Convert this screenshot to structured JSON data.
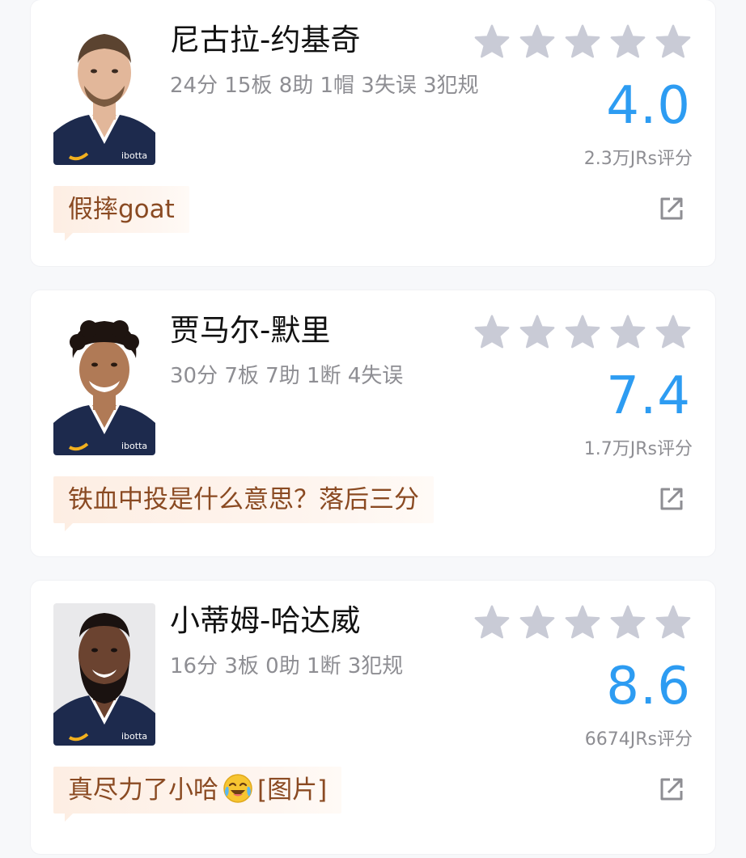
{
  "players": [
    {
      "name": "尼古拉-约基奇",
      "stats": "24分 15板 8助 1帽 3失误 3犯规",
      "score": "4.0",
      "rating_count": "2.3万JRs评分",
      "comment": "假摔goat",
      "stars_filled": 0,
      "skin": "#e2b79a",
      "hair": "#5b4330",
      "avatar_bg": "#ffffff"
    },
    {
      "name": "贾马尔-默里",
      "stats": "30分 7板 7助 1断 4失误",
      "score": "7.4",
      "rating_count": "1.7万JRs评分",
      "comment": "铁血中投是什么意思？落后三分",
      "stars_filled": 0,
      "skin": "#b07a56",
      "hair": "#1e1410",
      "avatar_bg": "#ffffff"
    },
    {
      "name": "小蒂姆-哈达威",
      "stats": "16分 3板 0助 1断 3犯规",
      "score": "8.6",
      "rating_count": "6674JRs评分",
      "comment": "真尽力了小哈",
      "comment_suffix": "[图片]",
      "stars_filled": 0,
      "skin": "#6b4330",
      "hair": "#1a1210",
      "avatar_bg": "#e9e9eb"
    }
  ],
  "colors": {
    "score": "#2d9cf2",
    "star_empty": "#c9cbd6",
    "comment_text": "#8a4a22",
    "stat_text": "#8e8e93"
  },
  "jersey": {
    "text": "ibotta",
    "color": "#1d2a4d"
  },
  "icons": {
    "star": "star-icon",
    "share": "share-icon",
    "emoji": "laughing-crying-emoji-icon"
  }
}
